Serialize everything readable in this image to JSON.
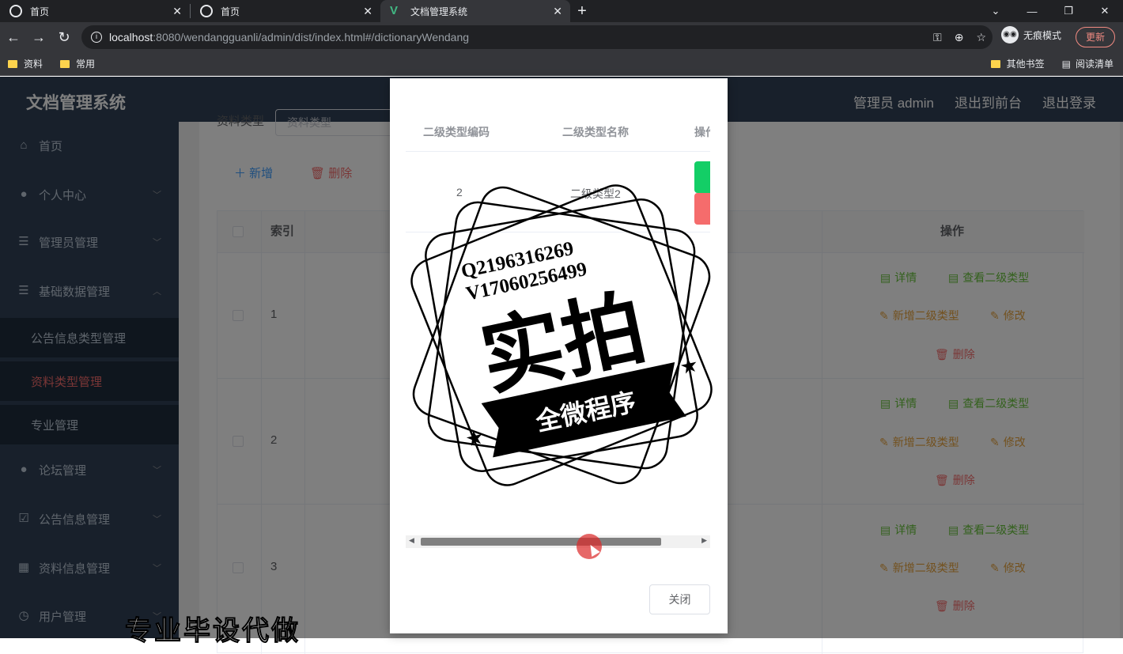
{
  "browser": {
    "tabs": [
      {
        "title": "首页",
        "active": false
      },
      {
        "title": "首页",
        "active": false
      },
      {
        "title": "文档管理系统",
        "active": true
      }
    ],
    "url_host": "localhost",
    "url_rest": ":8080/wendangguanli/admin/dist/index.html#/dictionaryWendang",
    "incognito_label": "无痕模式",
    "update_label": "更新",
    "bookmarks": [
      "资料",
      "常用"
    ],
    "bookmarks_right": [
      "其他书签",
      "阅读清单"
    ]
  },
  "app": {
    "brand": "文档管理系统",
    "top_links": [
      "管理员 admin",
      "退出到前台",
      "退出登录"
    ],
    "sidebar": {
      "items": [
        {
          "label": "首页",
          "icon": "home-icon"
        },
        {
          "label": "个人中心",
          "icon": "user-icon"
        },
        {
          "label": "管理员管理",
          "icon": "list-icon"
        },
        {
          "label": "基础数据管理",
          "icon": "list-icon"
        },
        {
          "label": "论坛管理",
          "icon": "user-icon"
        },
        {
          "label": "公告信息管理",
          "icon": "clipboard-icon"
        },
        {
          "label": "资料信息管理",
          "icon": "grid-icon"
        },
        {
          "label": "用户管理",
          "icon": "clock-icon"
        }
      ],
      "sub_items": [
        {
          "label": "公告信息类型管理",
          "active": false
        },
        {
          "label": "资料类型管理",
          "active": true
        },
        {
          "label": "专业管理",
          "active": false
        }
      ]
    },
    "filter": {
      "label": "资料类型",
      "placeholder": "资料类型"
    },
    "toolbar": {
      "add": "新增",
      "delete": "删除"
    },
    "table": {
      "headers": {
        "index": "索引",
        "actions": "操作"
      },
      "rows": [
        "1",
        "2",
        "3"
      ],
      "actions": {
        "detail": "详情",
        "view_sub": "查看二级类型",
        "add_sub": "新增二级类型",
        "edit": "修改",
        "delete": "删除"
      }
    }
  },
  "dialog": {
    "headers": [
      "二级类型编码",
      "二级类型名称",
      "操作"
    ],
    "row": {
      "code": "2",
      "name": "二级类型2"
    },
    "close_label": "关闭"
  },
  "watermark": {
    "line1": "Q2196316269",
    "line2": "V17060256499",
    "big": "实拍",
    "banner": "全微程序"
  },
  "overlay_text": "专业毕设代做",
  "colors": {
    "sidebar_bg": "#304156",
    "active_menu": "#f56c6c",
    "btn_green": "#13ce66",
    "btn_red": "#f56c6c"
  }
}
